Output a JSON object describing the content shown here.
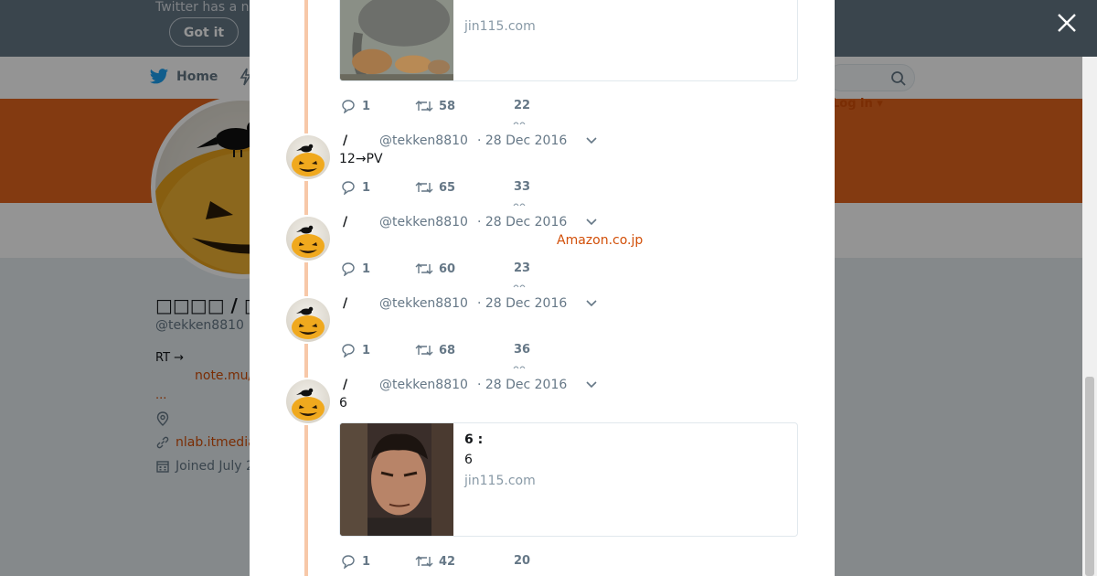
{
  "background_page": {
    "banner_text": "Twitter has a n",
    "got_it_button": "Got it",
    "nav_home": "Home",
    "login_label": "Log in ▾",
    "profile_name": "□□□□ / □□□",
    "profile_handle": "@tekken8810",
    "bio_text": "RT  →",
    "bio_link": "note.mu/",
    "bio_more": "...",
    "website": "nlab.itmedia",
    "joined": "Joined July 2"
  },
  "tweets": [
    {
      "card": {
        "domain": "jin115.com"
      },
      "actions": {
        "replies": "1",
        "retweets": "58",
        "likes": "22"
      }
    },
    {
      "name": "/",
      "handle": "@tekken8810",
      "date": "· 28 Dec 2016",
      "text": "12→PV",
      "actions": {
        "replies": "1",
        "retweets": "65",
        "likes": "33"
      }
    },
    {
      "name": "/",
      "handle": "@tekken8810",
      "date": "· 28 Dec 2016",
      "link": "Amazon.co.jp",
      "actions": {
        "replies": "1",
        "retweets": "60",
        "likes": "23"
      }
    },
    {
      "name": "/",
      "handle": "@tekken8810",
      "date": "· 28 Dec 2016",
      "actions": {
        "replies": "1",
        "retweets": "68",
        "likes": "36"
      }
    },
    {
      "name": "/",
      "handle": "@tekken8810",
      "date": "· 28 Dec 2016",
      "text": "6",
      "card": {
        "title": "6 :",
        "description": "6",
        "domain": "jin115.com"
      },
      "actions": {
        "replies": "1",
        "retweets": "42",
        "likes": "20"
      }
    }
  ],
  "icons": {
    "close": "close-icon",
    "reply": "reply-icon",
    "retweet": "retweet-icon",
    "like": "heart-icon",
    "caret": "chevron-down-icon",
    "search": "search-icon"
  },
  "colors": {
    "accent": "#e2641e",
    "link": "#d24f08",
    "muted": "#657786",
    "thread_line": "#f7c8a8"
  }
}
